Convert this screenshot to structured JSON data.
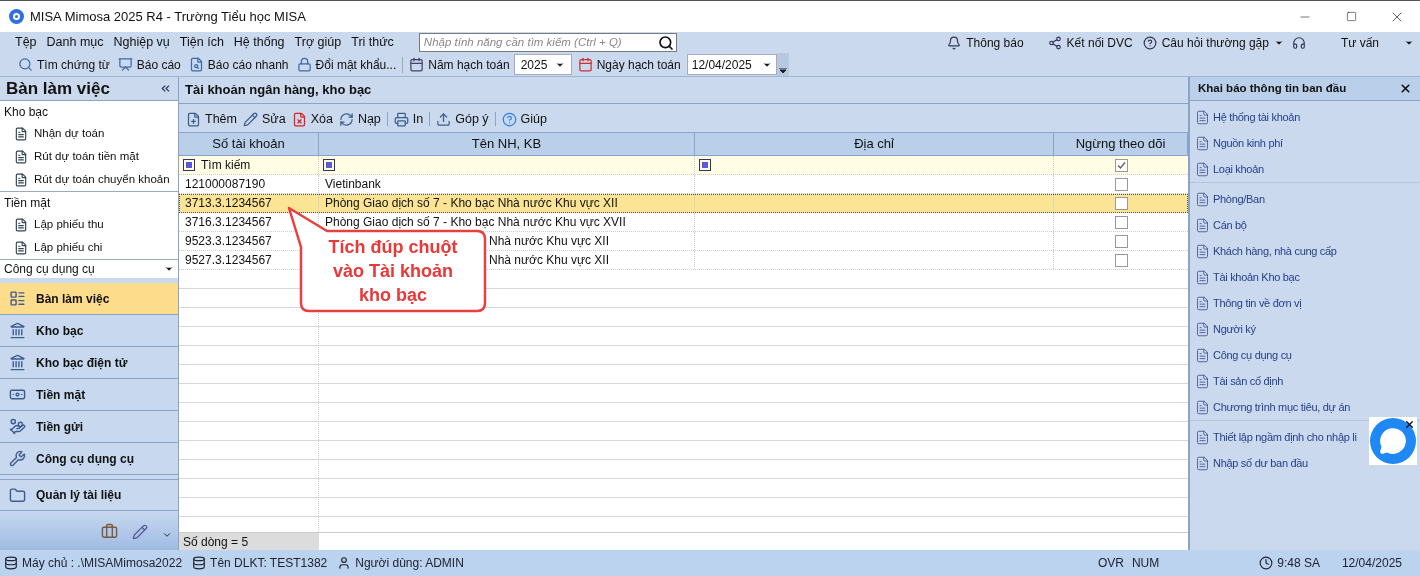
{
  "window": {
    "title": "MISA Mimosa 2025 R4 - Trường Tiểu học MISA"
  },
  "menu": [
    "Tệp",
    "Danh mục",
    "Nghiệp vụ",
    "Tiện ích",
    "Hệ thống",
    "Trợ giúp",
    "Tri thức"
  ],
  "search": {
    "placeholder": "Nhập tính năng cần tìm kiếm (Ctrl + Q)"
  },
  "top_links": [
    {
      "kind": "bell",
      "label": "Thông báo"
    },
    {
      "kind": "connect",
      "label": "Kết nối DVC"
    },
    {
      "kind": "help",
      "label": "Câu hỏi thường gặp"
    },
    {
      "kind": "headset",
      "label": "Tư vấn"
    }
  ],
  "toolbar": [
    {
      "kind": "search",
      "label": "Tìm chứng từ"
    },
    {
      "kind": "report",
      "label": "Báo cáo"
    },
    {
      "kind": "quick",
      "label": "Báo cáo nhanh"
    },
    {
      "kind": "lock",
      "label": "Đổi mật khẩu..."
    }
  ],
  "fiscal_year": {
    "label": "Năm hạch toán",
    "value": "2025"
  },
  "posting_date": {
    "label": "Ngày hạch toán",
    "value": "12/04/2025"
  },
  "sidebar": {
    "title": "Bàn làm việc",
    "groups": [
      {
        "label": "Kho bạc",
        "items": [
          "Nhận dự toán",
          "Rút dự toán tiền mặt",
          "Rút dự toán chuyển khoản"
        ]
      },
      {
        "label": "Tiền mặt",
        "items": [
          "Lập phiếu thu",
          "Lập phiếu chi"
        ]
      }
    ],
    "dropdown": "Công cụ dụng cụ",
    "nav": [
      {
        "kind": "desk",
        "label": "Bàn làm việc",
        "selected": true
      },
      {
        "kind": "bank",
        "label": "Kho bạc",
        "selected": false
      },
      {
        "kind": "ebank",
        "label": "Kho bạc điện tử",
        "selected": false
      },
      {
        "kind": "cash",
        "label": "Tiền mặt",
        "selected": false
      },
      {
        "kind": "deposit",
        "label": "Tiền gửi",
        "selected": false
      },
      {
        "kind": "tools",
        "label": "Công cụ dụng cụ",
        "selected": false
      },
      {
        "kind": "folder",
        "label": "Quản lý tài liệu",
        "selected": false
      }
    ]
  },
  "content": {
    "title": "Tài khoản ngân hàng, kho bạc",
    "actions": [
      {
        "kind": "add",
        "label": "Thêm"
      },
      {
        "kind": "edit",
        "label": "Sửa"
      },
      {
        "kind": "delete",
        "label": "Xóa"
      },
      {
        "kind": "reload",
        "label": "Nạp"
      },
      {
        "kind": "print",
        "label": "In"
      },
      {
        "kind": "feedback",
        "label": "Góp ý"
      },
      {
        "kind": "help",
        "label": "Giúp"
      }
    ],
    "table": {
      "columns": [
        "Số tài khoản",
        "Tên NH, KB",
        "Địa chỉ",
        "Ngừng theo dõi"
      ],
      "filter": {
        "placeholder": "Tìm kiếm",
        "checked": true
      },
      "rows": [
        {
          "kind": "plain",
          "account": "121000087190",
          "name": "Vietinbank",
          "stopped": false,
          "selected": false
        },
        {
          "kind": "plain",
          "account": "3713.3.1234567",
          "name": "Phòng Giao dịch số 7 - Kho bạc Nhà nước Khu vực XII",
          "stopped": false,
          "selected": true
        },
        {
          "kind": "plain",
          "account": "3716.3.1234567",
          "name": "Phòng Giao dịch số 7 - Kho bạc Nhà nước Khu vực XVII",
          "stopped": false,
          "selected": false
        },
        {
          "kind": "covered",
          "account": "9523.3.1234567",
          "name": "Nhà nước Khu vực XII",
          "stopped": false,
          "selected": false
        },
        {
          "kind": "covered",
          "account": "9527.3.1234567",
          "name": "Nhà nước Khu vực XII",
          "stopped": false,
          "selected": false
        }
      ],
      "footer": "Số dòng = 5"
    },
    "callout": "Tích đúp chuột vào Tài khoản kho bạc"
  },
  "right_panel": {
    "title": "Khai báo thông tin ban đầu",
    "sections": [
      [
        "Hệ thống tài khoản",
        "Nguồn kinh phí",
        "Loại khoản"
      ],
      [
        "Phòng/Ban",
        "Cán bộ",
        "Khách hàng, nhà cung cấp",
        "Tài khoản Kho bạc",
        "Thông tin về đơn vị",
        "Người ký",
        "Công cụ dụng cụ",
        "Tài sản cố định",
        "Chương trình mục tiêu, dự án"
      ],
      [
        "Thiết lập ngầm định cho nhập li",
        "Nhập số dư ban đầu"
      ]
    ]
  },
  "status_bar": {
    "server": "Máy chủ : .\\MISAMimosa2022",
    "database": "Tên DLKT: TEST1382",
    "user": "Người dùng: ADMIN",
    "ovr": "OVR",
    "num": "NUM",
    "time": "9:48 SA",
    "date": "12/04/2025"
  }
}
